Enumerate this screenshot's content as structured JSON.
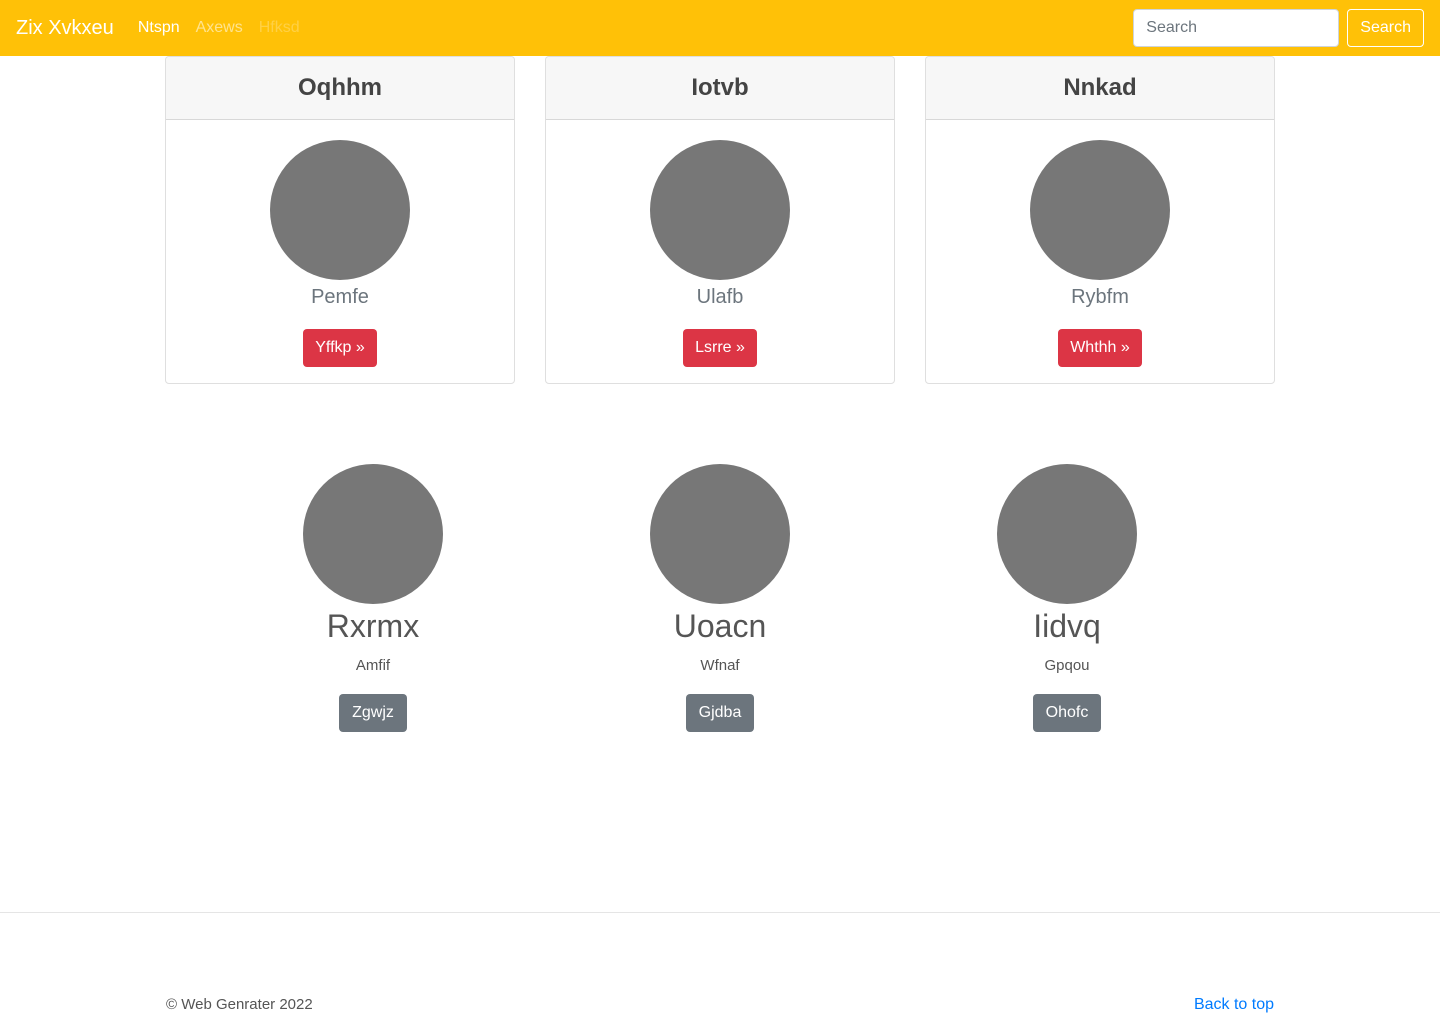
{
  "navbar": {
    "brand": "Zix Xvkxeu",
    "links": [
      {
        "label": "Ntspn",
        "state": "active"
      },
      {
        "label": "Axews",
        "state": "normal"
      },
      {
        "label": "Hfksd",
        "state": "disabled"
      }
    ],
    "search": {
      "placeholder": "Search",
      "value": "",
      "button_label": "Search"
    }
  },
  "cards": [
    {
      "title": "Oqhhm",
      "subtitle": "Pemfe",
      "button_label": "Yffkp »"
    },
    {
      "title": "Iotvb",
      "subtitle": "Ulafb",
      "button_label": "Lsrre »"
    },
    {
      "title": "Nnkad",
      "subtitle": "Rybfm",
      "button_label": "Whthh »"
    }
  ],
  "features": [
    {
      "name": "Rxrmx",
      "text": "Amfif",
      "button_label": "Zgwjz"
    },
    {
      "name": "Uoacn",
      "text": "Wfnaf",
      "button_label": "Gjdba"
    },
    {
      "name": "Iidvq",
      "text": "Gpqou",
      "button_label": "Ohofc"
    }
  ],
  "footer": {
    "copyright": "© Web Genrater 2022",
    "back_to_top": "Back to top"
  },
  "colors": {
    "navbar_bg": "#ffc107",
    "danger": "#dc3545",
    "secondary": "#6c757d",
    "avatar_placeholder": "#777777",
    "link": "#007bff"
  }
}
